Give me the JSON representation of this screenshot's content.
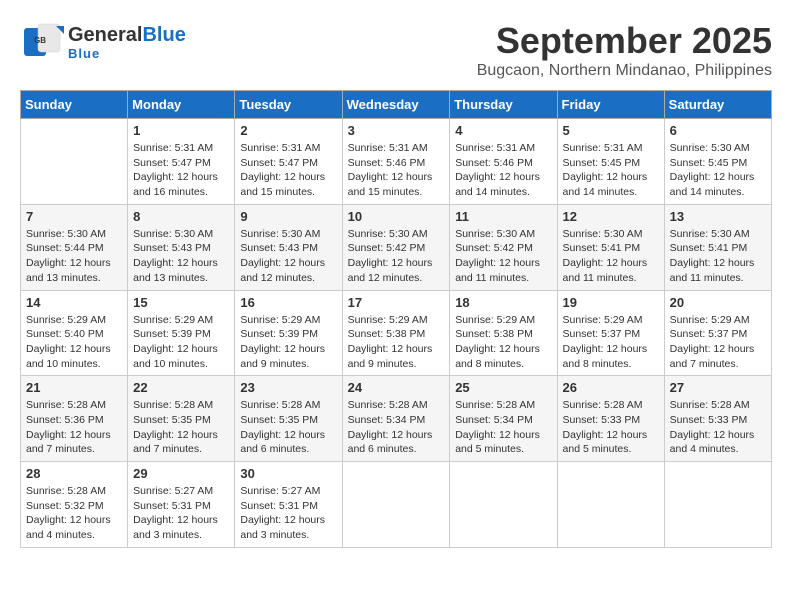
{
  "header": {
    "logo_general": "General",
    "logo_blue": "Blue",
    "month": "September 2025",
    "location": "Bugcaon, Northern Mindanao, Philippines"
  },
  "days_of_week": [
    "Sunday",
    "Monday",
    "Tuesday",
    "Wednesday",
    "Thursday",
    "Friday",
    "Saturday"
  ],
  "weeks": [
    [
      {
        "day": "",
        "sunrise": "",
        "sunset": "",
        "daylight": ""
      },
      {
        "day": "1",
        "sunrise": "Sunrise: 5:31 AM",
        "sunset": "Sunset: 5:47 PM",
        "daylight": "Daylight: 12 hours and 16 minutes."
      },
      {
        "day": "2",
        "sunrise": "Sunrise: 5:31 AM",
        "sunset": "Sunset: 5:47 PM",
        "daylight": "Daylight: 12 hours and 15 minutes."
      },
      {
        "day": "3",
        "sunrise": "Sunrise: 5:31 AM",
        "sunset": "Sunset: 5:46 PM",
        "daylight": "Daylight: 12 hours and 15 minutes."
      },
      {
        "day": "4",
        "sunrise": "Sunrise: 5:31 AM",
        "sunset": "Sunset: 5:46 PM",
        "daylight": "Daylight: 12 hours and 14 minutes."
      },
      {
        "day": "5",
        "sunrise": "Sunrise: 5:31 AM",
        "sunset": "Sunset: 5:45 PM",
        "daylight": "Daylight: 12 hours and 14 minutes."
      },
      {
        "day": "6",
        "sunrise": "Sunrise: 5:30 AM",
        "sunset": "Sunset: 5:45 PM",
        "daylight": "Daylight: 12 hours and 14 minutes."
      }
    ],
    [
      {
        "day": "7",
        "sunrise": "Sunrise: 5:30 AM",
        "sunset": "Sunset: 5:44 PM",
        "daylight": "Daylight: 12 hours and 13 minutes."
      },
      {
        "day": "8",
        "sunrise": "Sunrise: 5:30 AM",
        "sunset": "Sunset: 5:43 PM",
        "daylight": "Daylight: 12 hours and 13 minutes."
      },
      {
        "day": "9",
        "sunrise": "Sunrise: 5:30 AM",
        "sunset": "Sunset: 5:43 PM",
        "daylight": "Daylight: 12 hours and 12 minutes."
      },
      {
        "day": "10",
        "sunrise": "Sunrise: 5:30 AM",
        "sunset": "Sunset: 5:42 PM",
        "daylight": "Daylight: 12 hours and 12 minutes."
      },
      {
        "day": "11",
        "sunrise": "Sunrise: 5:30 AM",
        "sunset": "Sunset: 5:42 PM",
        "daylight": "Daylight: 12 hours and 11 minutes."
      },
      {
        "day": "12",
        "sunrise": "Sunrise: 5:30 AM",
        "sunset": "Sunset: 5:41 PM",
        "daylight": "Daylight: 12 hours and 11 minutes."
      },
      {
        "day": "13",
        "sunrise": "Sunrise: 5:30 AM",
        "sunset": "Sunset: 5:41 PM",
        "daylight": "Daylight: 12 hours and 11 minutes."
      }
    ],
    [
      {
        "day": "14",
        "sunrise": "Sunrise: 5:29 AM",
        "sunset": "Sunset: 5:40 PM",
        "daylight": "Daylight: 12 hours and 10 minutes."
      },
      {
        "day": "15",
        "sunrise": "Sunrise: 5:29 AM",
        "sunset": "Sunset: 5:39 PM",
        "daylight": "Daylight: 12 hours and 10 minutes."
      },
      {
        "day": "16",
        "sunrise": "Sunrise: 5:29 AM",
        "sunset": "Sunset: 5:39 PM",
        "daylight": "Daylight: 12 hours and 9 minutes."
      },
      {
        "day": "17",
        "sunrise": "Sunrise: 5:29 AM",
        "sunset": "Sunset: 5:38 PM",
        "daylight": "Daylight: 12 hours and 9 minutes."
      },
      {
        "day": "18",
        "sunrise": "Sunrise: 5:29 AM",
        "sunset": "Sunset: 5:38 PM",
        "daylight": "Daylight: 12 hours and 8 minutes."
      },
      {
        "day": "19",
        "sunrise": "Sunrise: 5:29 AM",
        "sunset": "Sunset: 5:37 PM",
        "daylight": "Daylight: 12 hours and 8 minutes."
      },
      {
        "day": "20",
        "sunrise": "Sunrise: 5:29 AM",
        "sunset": "Sunset: 5:37 PM",
        "daylight": "Daylight: 12 hours and 7 minutes."
      }
    ],
    [
      {
        "day": "21",
        "sunrise": "Sunrise: 5:28 AM",
        "sunset": "Sunset: 5:36 PM",
        "daylight": "Daylight: 12 hours and 7 minutes."
      },
      {
        "day": "22",
        "sunrise": "Sunrise: 5:28 AM",
        "sunset": "Sunset: 5:35 PM",
        "daylight": "Daylight: 12 hours and 7 minutes."
      },
      {
        "day": "23",
        "sunrise": "Sunrise: 5:28 AM",
        "sunset": "Sunset: 5:35 PM",
        "daylight": "Daylight: 12 hours and 6 minutes."
      },
      {
        "day": "24",
        "sunrise": "Sunrise: 5:28 AM",
        "sunset": "Sunset: 5:34 PM",
        "daylight": "Daylight: 12 hours and 6 minutes."
      },
      {
        "day": "25",
        "sunrise": "Sunrise: 5:28 AM",
        "sunset": "Sunset: 5:34 PM",
        "daylight": "Daylight: 12 hours and 5 minutes."
      },
      {
        "day": "26",
        "sunrise": "Sunrise: 5:28 AM",
        "sunset": "Sunset: 5:33 PM",
        "daylight": "Daylight: 12 hours and 5 minutes."
      },
      {
        "day": "27",
        "sunrise": "Sunrise: 5:28 AM",
        "sunset": "Sunset: 5:33 PM",
        "daylight": "Daylight: 12 hours and 4 minutes."
      }
    ],
    [
      {
        "day": "28",
        "sunrise": "Sunrise: 5:28 AM",
        "sunset": "Sunset: 5:32 PM",
        "daylight": "Daylight: 12 hours and 4 minutes."
      },
      {
        "day": "29",
        "sunrise": "Sunrise: 5:27 AM",
        "sunset": "Sunset: 5:31 PM",
        "daylight": "Daylight: 12 hours and 3 minutes."
      },
      {
        "day": "30",
        "sunrise": "Sunrise: 5:27 AM",
        "sunset": "Sunset: 5:31 PM",
        "daylight": "Daylight: 12 hours and 3 minutes."
      },
      {
        "day": "",
        "sunrise": "",
        "sunset": "",
        "daylight": ""
      },
      {
        "day": "",
        "sunrise": "",
        "sunset": "",
        "daylight": ""
      },
      {
        "day": "",
        "sunrise": "",
        "sunset": "",
        "daylight": ""
      },
      {
        "day": "",
        "sunrise": "",
        "sunset": "",
        "daylight": ""
      }
    ]
  ]
}
